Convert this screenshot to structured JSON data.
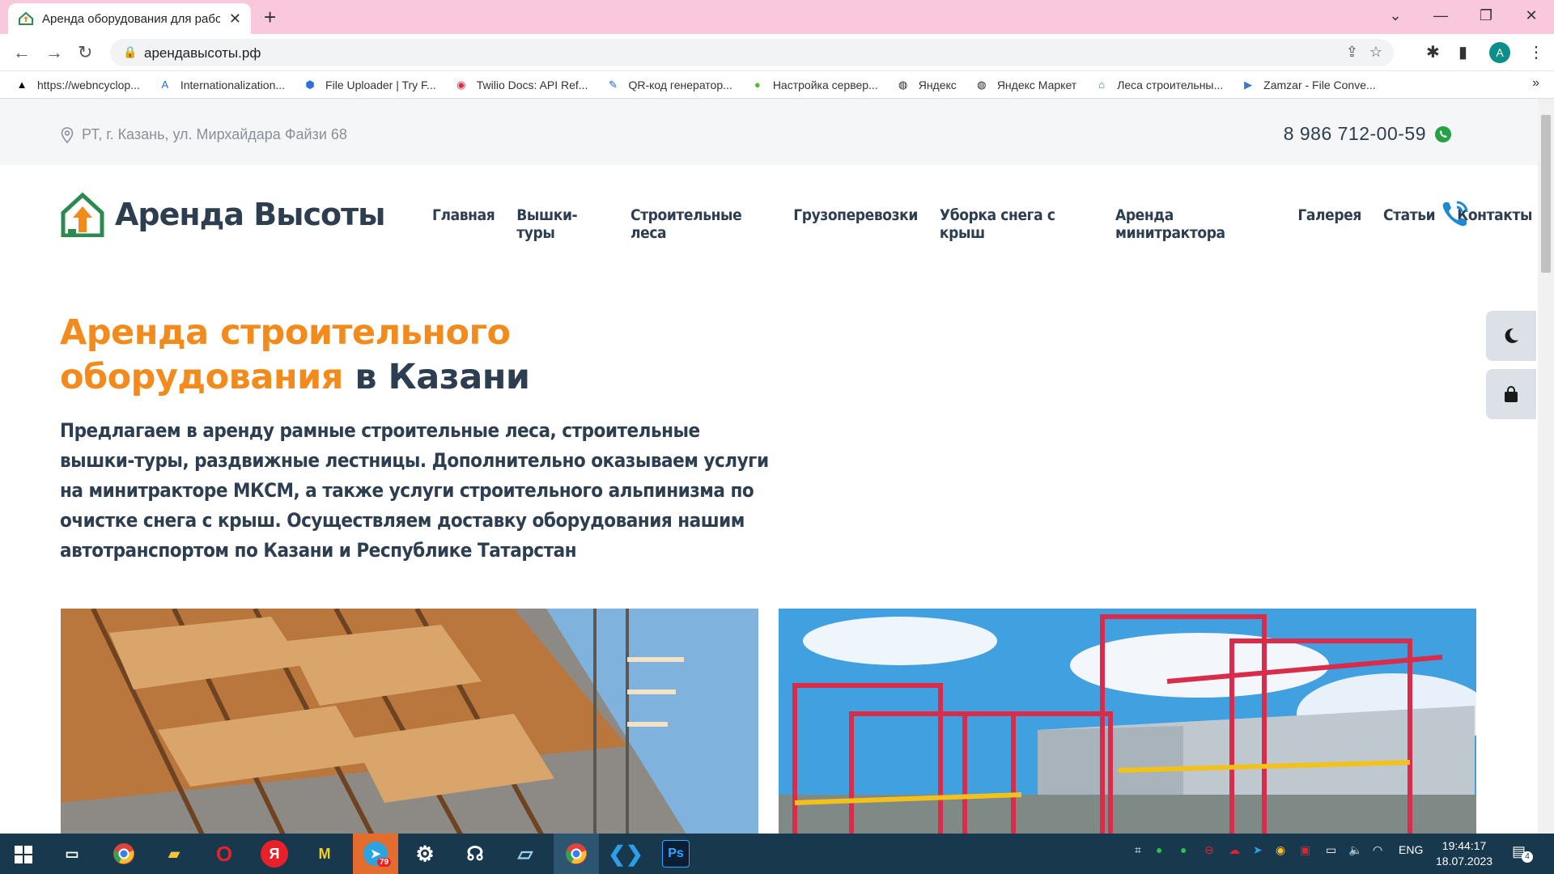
{
  "browser": {
    "tab_title": "Аренда оборудования для рабо",
    "url": "арендавысоты.рф",
    "profile_initial": "A",
    "bookmarks": [
      {
        "label": "https://webncyclop...",
        "icon": "wiki-icon"
      },
      {
        "label": "Internationalization...",
        "icon": "azure-icon"
      },
      {
        "label": "File Uploader | Try F...",
        "icon": "uploader-icon"
      },
      {
        "label": "Twilio Docs: API Ref...",
        "icon": "twilio-icon"
      },
      {
        "label": "QR-код генератор...",
        "icon": "pen-icon"
      },
      {
        "label": "Настройка сервер...",
        "icon": "leaf-icon"
      },
      {
        "label": "Яндекс",
        "icon": "globe-icon"
      },
      {
        "label": "Яндекс Маркет",
        "icon": "globe-icon"
      },
      {
        "label": "Леса строительны...",
        "icon": "house-icon"
      },
      {
        "label": "Zamzar - File Conve...",
        "icon": "zamzar-icon"
      }
    ]
  },
  "site": {
    "address": "РТ, г. Казань, ул. Мирхайдара Файзи 68",
    "phone": "8 986 712-00-59",
    "logo_text": "Аренда Высоты",
    "menu": [
      "Главная",
      "Вышки-туры",
      "Строительные леса",
      "Грузоперевозки",
      "Уборка снега с крыш",
      "Аренда минитрактора",
      "Галерея",
      "Статьи",
      "Контакты"
    ],
    "hero_title_orange_1": "Аренда строительного",
    "hero_title_orange_2": "оборудования",
    "hero_title_dark": "в Казани",
    "hero_text": "Предлагаем в аренду рамные строительные леса, строительные вышки-туры, раздвижные лестницы. Дополнительно оказываем услуги на минитракторе МКСМ, а также услуги строительного альпинизма по очистке снега с крыш. Осуществляем доставку оборудования нашим автотранспортом по Казани и Республике Татарстан",
    "accent_color": "#f28a1c",
    "dark_color": "#2c3e50"
  },
  "taskbar": {
    "language": "ENG",
    "time": "19:44:17",
    "date": "18.07.2023",
    "notifications": "4",
    "telegram_badge": "79"
  }
}
